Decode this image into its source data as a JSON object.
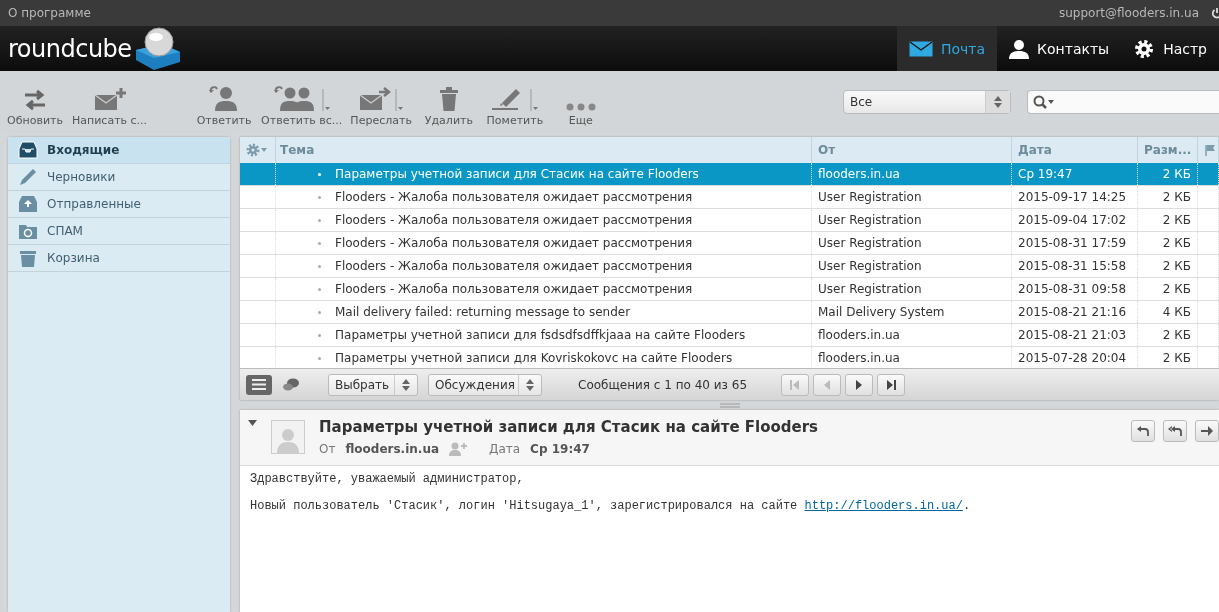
{
  "topbar": {
    "about": "О программе",
    "user": "support@flooders.in.ua"
  },
  "logo": {
    "text": "roundcube"
  },
  "nav": [
    {
      "label": "Почта",
      "selected": true
    },
    {
      "label": "Контакты",
      "selected": false
    },
    {
      "label": "Настр",
      "selected": false
    }
  ],
  "toolbar": [
    {
      "label": "Обновить",
      "menu": false
    },
    {
      "label": "Написать с...",
      "menu": false
    },
    {
      "label": "Ответить",
      "menu": false
    },
    {
      "label": "Ответить вс...",
      "menu": true
    },
    {
      "label": "Переслать",
      "menu": true
    },
    {
      "label": "Удалить",
      "menu": false
    },
    {
      "label": "Пометить",
      "menu": true
    },
    {
      "label": "Еще",
      "menu": false
    }
  ],
  "filter": {
    "value": "Все"
  },
  "folders": [
    {
      "label": "Входящие",
      "selected": true
    },
    {
      "label": "Черновики",
      "selected": false
    },
    {
      "label": "Отправленные",
      "selected": false
    },
    {
      "label": "СПАМ",
      "selected": false
    },
    {
      "label": "Корзина",
      "selected": false
    }
  ],
  "table": {
    "columns": [
      "Тема",
      "От",
      "Дата",
      "Разм..."
    ],
    "rows": [
      {
        "subject": "Параметры учетной записи для Стасик на сайте Flooders",
        "from": "flooders.in.ua",
        "date": "Ср 19:47",
        "size": "2 КБ",
        "selected": true
      },
      {
        "subject": "Flooders - Жалоба пользователя ожидает рассмотрения",
        "from": "User Registration",
        "date": "2015-09-17 14:25",
        "size": "2 КБ",
        "selected": false
      },
      {
        "subject": "Flooders - Жалоба пользователя ожидает рассмотрения",
        "from": "User Registration",
        "date": "2015-09-04 17:02",
        "size": "2 КБ",
        "selected": false
      },
      {
        "subject": "Flooders - Жалоба пользователя ожидает рассмотрения",
        "from": "User Registration",
        "date": "2015-08-31 17:59",
        "size": "2 КБ",
        "selected": false
      },
      {
        "subject": "Flooders - Жалоба пользователя ожидает рассмотрения",
        "from": "User Registration",
        "date": "2015-08-31 15:58",
        "size": "2 КБ",
        "selected": false
      },
      {
        "subject": "Flooders - Жалоба пользователя ожидает рассмотрения",
        "from": "User Registration",
        "date": "2015-08-31 09:58",
        "size": "2 КБ",
        "selected": false
      },
      {
        "subject": "Mail delivery failed: returning message to sender",
        "from": "Mail Delivery System",
        "date": "2015-08-21 21:16",
        "size": "4 КБ",
        "selected": false
      },
      {
        "subject": "Параметры учетной записи для fsdsdfsdffkjaaa на сайте Flooders",
        "from": "flooders.in.ua",
        "date": "2015-08-21 21:03",
        "size": "2 КБ",
        "selected": false
      },
      {
        "subject": "Параметры учетной записи для Kovriskokovc на сайте Flooders",
        "from": "flooders.in.ua",
        "date": "2015-07-28 20:04",
        "size": "2 КБ",
        "selected": false
      }
    ]
  },
  "list_footer": {
    "select": "Выбрать",
    "threads": "Обсуждения",
    "count": "Сообщения с 1 по 40 из 65"
  },
  "preview": {
    "subject": "Параметры учетной записи для Стасик на сайте Flooders",
    "from_label": "От",
    "from": "flooders.in.ua",
    "date_label": "Дата",
    "date": "Ср 19:47",
    "body": [
      {
        "text": "Здравствуйте, уважаемый администратор,"
      },
      {
        "text": "Новый пользователь 'Стасик', логин 'Hitsugaya_1', зарегистрировался на сайте ",
        "link": "http://flooders.in.ua/",
        "after": "."
      }
    ]
  }
}
